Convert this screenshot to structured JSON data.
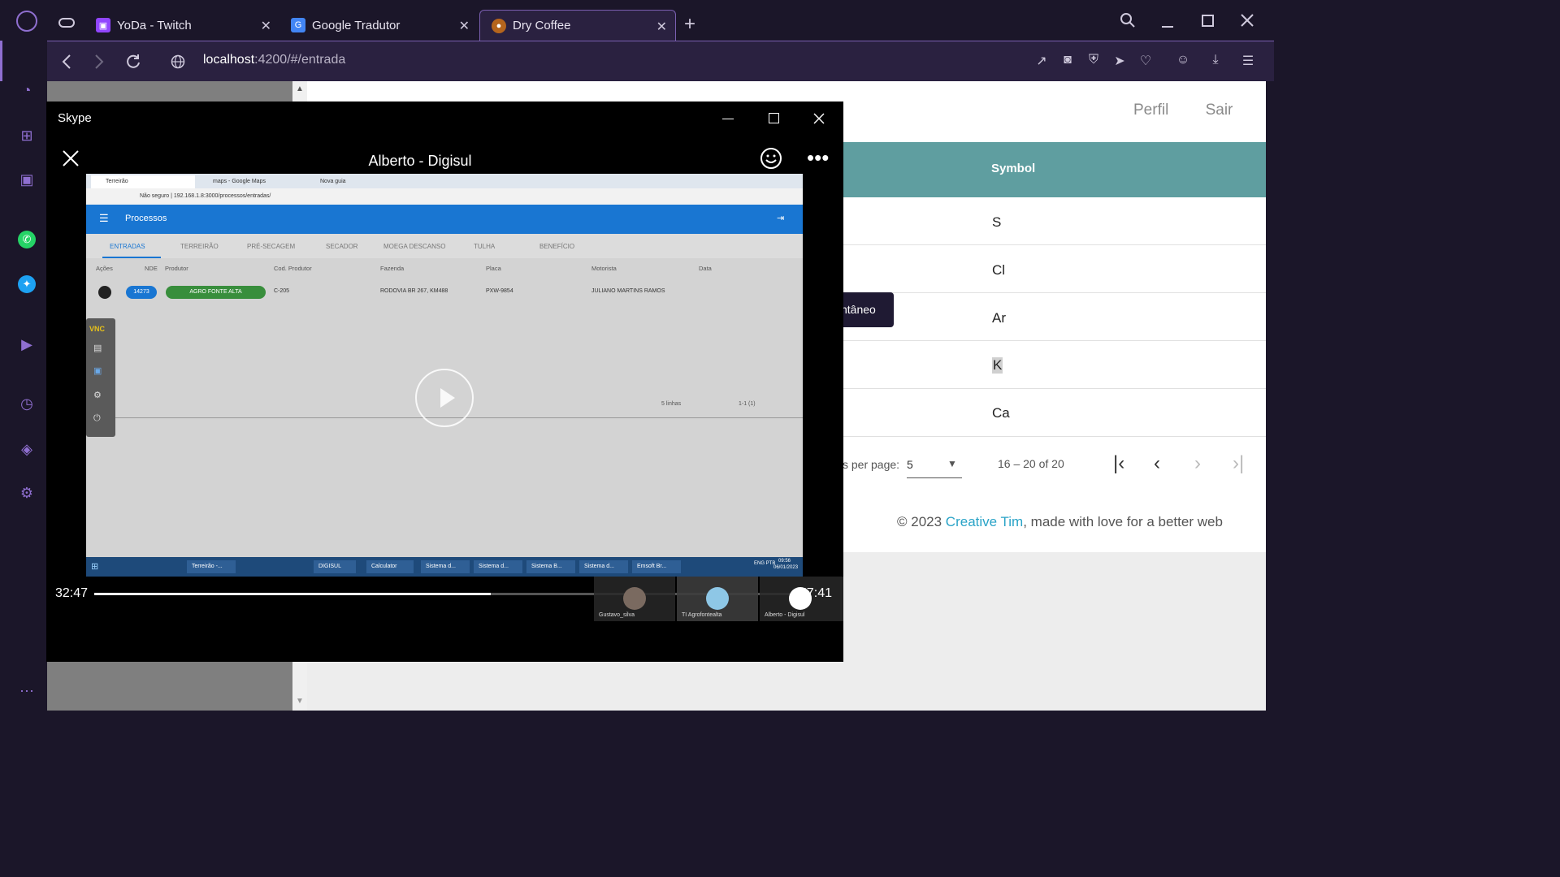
{
  "browser": {
    "tabs": [
      {
        "label": "YoDa - Twitch",
        "close": "✕"
      },
      {
        "label": "Google Tradutor",
        "close": "✕"
      },
      {
        "label": "Dry Coffee",
        "close": "✕"
      }
    ],
    "new_tab": "+",
    "url_host": "localhost",
    "url_path": ":4200/#/entrada"
  },
  "page": {
    "header_links": {
      "profile": "Perfil",
      "logout": "Sair"
    },
    "column_header": "Symbol",
    "symbols": [
      "S",
      "Cl",
      "Ar",
      "K",
      "Ca"
    ],
    "tooltip": "ntâneo",
    "paginator": {
      "items_per_page_label": "s per page:",
      "page_size": "5",
      "range": "16 – 20 of 20"
    },
    "footer": {
      "prefix": "© 2023 ",
      "link": "Creative Tim",
      "suffix": ", made with love for a better web"
    }
  },
  "skype": {
    "window_title": "Skype",
    "call_title": "Alberto - Digisul",
    "time_elapsed": "32:47",
    "time_total": "57:41",
    "progress": 0.568,
    "participants": [
      {
        "name": "Gustavo_silva"
      },
      {
        "name": "TI Agrofontealta"
      },
      {
        "name": "Alberto - Digisul"
      }
    ]
  },
  "shared_screen": {
    "tabs": [
      "Terreirão",
      "maps - Google Maps",
      "Nova guia"
    ],
    "url": "Não seguro | 192.168.1.8:3000/processos/entradas/",
    "app_title": "Processos",
    "nav_tabs": [
      "ENTRADAS",
      "TERREIRÃO",
      "PRÉ-SECAGEM",
      "SECADOR",
      "MOEGA DESCANSO",
      "TULHA",
      "BENEFÍCIO"
    ],
    "columns": [
      "Ações",
      "NDE",
      "Produtor",
      "Cod. Produtor",
      "Fazenda",
      "Placa",
      "Motorista",
      "Data"
    ],
    "row": {
      "nde": "14273",
      "produtor": "AGRO FONTE ALTA",
      "cod": "C-205",
      "fazenda": "RODOVIA BR 267, KM488",
      "placa": "PXW-9854",
      "motorista": "JULIANO MARTINS RAMOS"
    },
    "pager": {
      "rows": "5 linhas",
      "range": "1-1 (1)"
    },
    "taskbar": [
      "Terreirão -...",
      "DIGISUL",
      "Calculator",
      "Sistema d...",
      "Sistema d...",
      "Sistema B...",
      "Sistema d...",
      "Emsoft Br..."
    ],
    "clock_time": "09:56",
    "clock_date": "06/01/2023",
    "lang": "ENG PTB",
    "vnc_label": "VNC"
  }
}
